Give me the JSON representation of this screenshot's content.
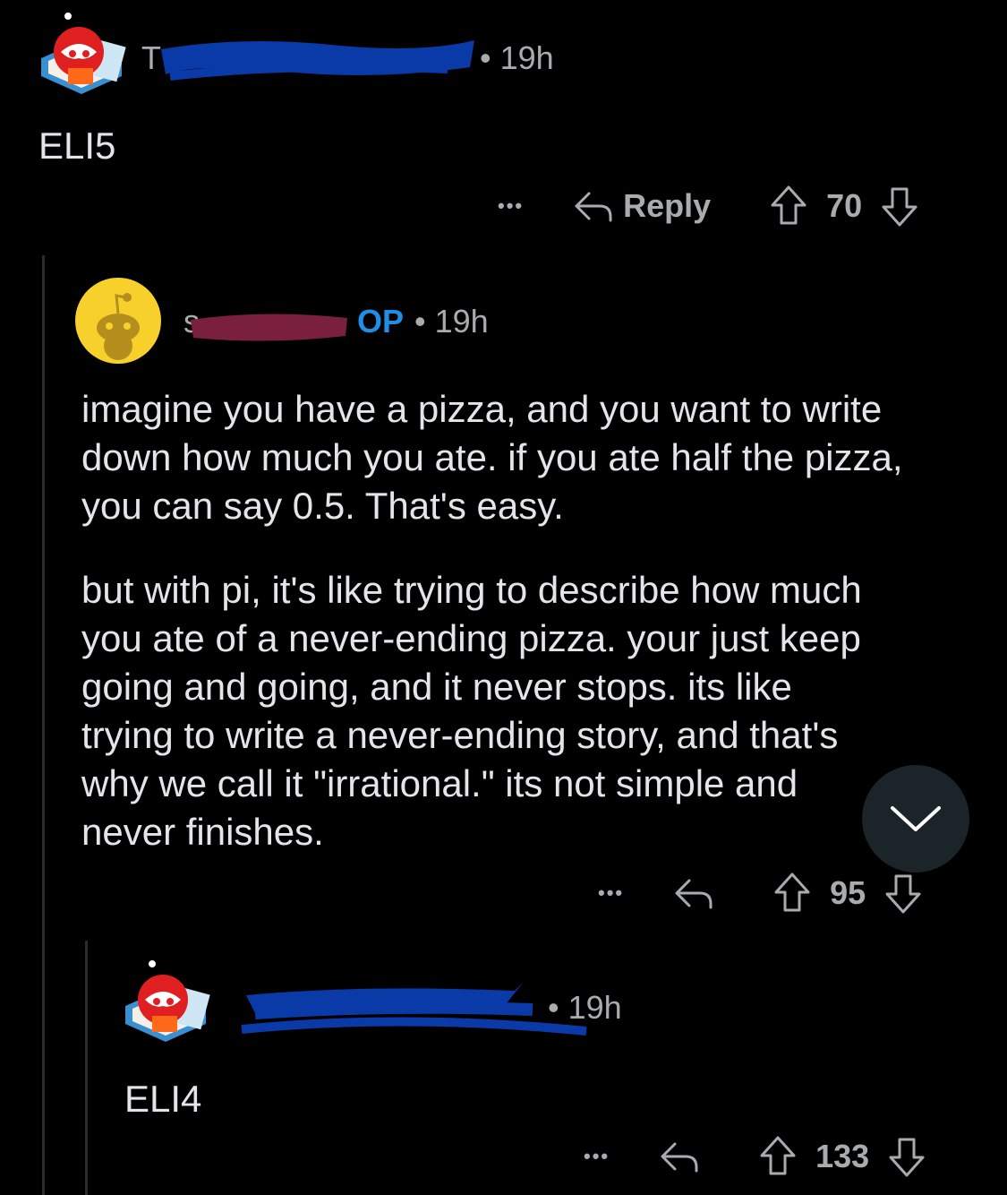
{
  "comments": [
    {
      "username": "T",
      "time": "• 19h",
      "text": "ELI5",
      "votes": "70",
      "reply_label": "Reply"
    },
    {
      "username": "s",
      "op_badge": "OP",
      "time": "• 19h",
      "paragraphs": [
        "imagine you have a pizza, and you want to write down how much you ate. if you ate half the pizza, you can say 0.5. That's easy.",
        "but with pi, it's like trying to describe how much you ate of a never-ending pizza. your just keep going and going, and it never stops. its like trying to write a never-ending story, and that's why we call it \"irrational.\" its not simple and never finishes."
      ],
      "votes": "95"
    },
    {
      "username": "",
      "time": "• 19h",
      "text": "ELI4",
      "votes": "133"
    }
  ],
  "more_options": "•••",
  "colors": {
    "background": "#000000",
    "op_badge": "#1e8ee6",
    "redaction_blue": "#0a3aa8",
    "redaction_maroon": "#7a1f3d",
    "fab": "#1b2428"
  },
  "icons": [
    "avatar-snoo-red",
    "avatar-snoo-yellow",
    "reply-icon",
    "upvote-icon",
    "downvote-icon",
    "more-icon",
    "chevron-down-icon"
  ]
}
